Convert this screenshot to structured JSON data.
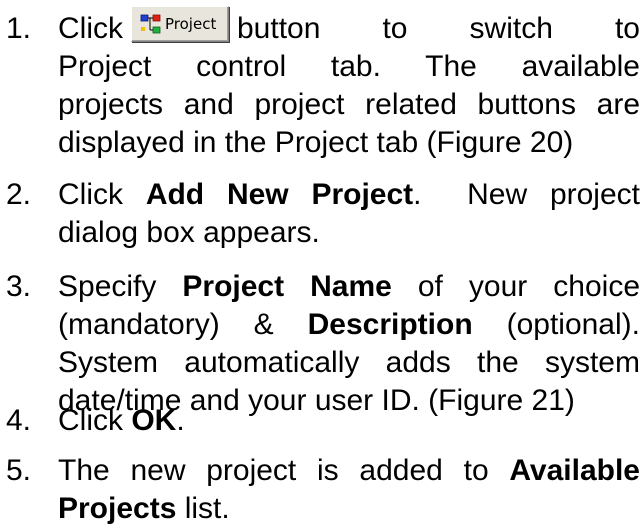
{
  "steps": [
    {
      "number": "1.",
      "lines": [
        {
          "pre": "Click",
          "button_label": "Project",
          "post": "button to switch to"
        },
        {
          "text": "Project control tab. The available"
        },
        {
          "text": "projects and project related buttons are"
        },
        {
          "text": "displayed in the Project tab (Figure 20)"
        }
      ]
    },
    {
      "number": "2.",
      "line1_pre": "Click ",
      "line1_bold": "Add New Project",
      "line1_post": ".  New project",
      "line2": "dialog box appears."
    },
    {
      "number": "3.",
      "line1_pre": "Specify ",
      "line1_bold": "Project Name",
      "line1_post": " of your choice",
      "line2_pre": "(mandatory) & ",
      "line2_bold": "Description",
      "line2_post": " (optional).",
      "line3": "System automatically adds the system",
      "line4": "date/time and your user ID. (Figure 21)"
    },
    {
      "number": "4.",
      "pre": "Click ",
      "bold": "OK",
      "post": "."
    },
    {
      "number": "5.",
      "line1_pre": "The new project is added to ",
      "line1_bold": "Available",
      "line2_bold": "Projects",
      "line2_post": " list."
    }
  ],
  "icons": {
    "project_button_icon": "project-hierarchy-icon"
  },
  "colors": {
    "button_face": "#e8e6dc",
    "icon_blue": "#1f3fd0",
    "icon_red": "#e02010",
    "icon_green": "#20b040",
    "icon_yellow": "#f0c000"
  }
}
